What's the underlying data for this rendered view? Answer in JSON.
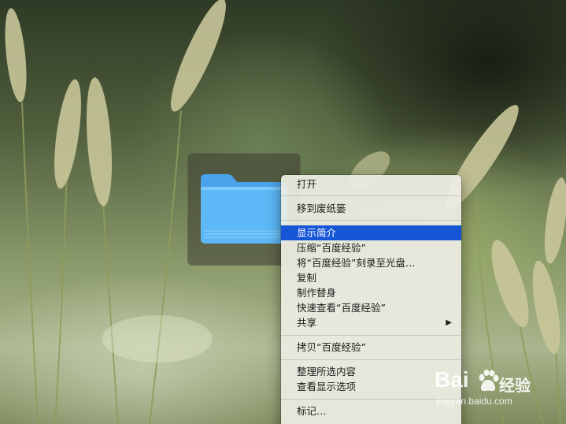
{
  "desktop": {
    "folder": {
      "icon": "folder-icon",
      "color": "#5bb7f5",
      "selected": true
    }
  },
  "context_menu": {
    "groups": [
      [
        {
          "label": "打开"
        }
      ],
      [
        {
          "label": "移到废纸篓"
        }
      ],
      [
        {
          "label": "显示简介",
          "highlighted": true
        },
        {
          "label": "压缩“百度经验”"
        },
        {
          "label": "将“百度经验”刻录至光盘…"
        },
        {
          "label": "复制"
        },
        {
          "label": "制作替身"
        },
        {
          "label": "快速查看“百度经验”"
        },
        {
          "label": "共享",
          "has_submenu": true,
          "submenu_icon": "chevron-right-icon"
        }
      ],
      [
        {
          "label": "拷贝“百度经验”"
        }
      ],
      [
        {
          "label": "整理所选内容"
        },
        {
          "label": "查看显示选项"
        }
      ],
      [
        {
          "label": "标记…"
        }
      ]
    ],
    "highlight_color": "#1656d6"
  },
  "watermark": {
    "logo_text": "Bai",
    "logo_icon": "baidu-paw-icon",
    "logo_suffix": "经验",
    "url": "jingyan.baidu.com"
  }
}
